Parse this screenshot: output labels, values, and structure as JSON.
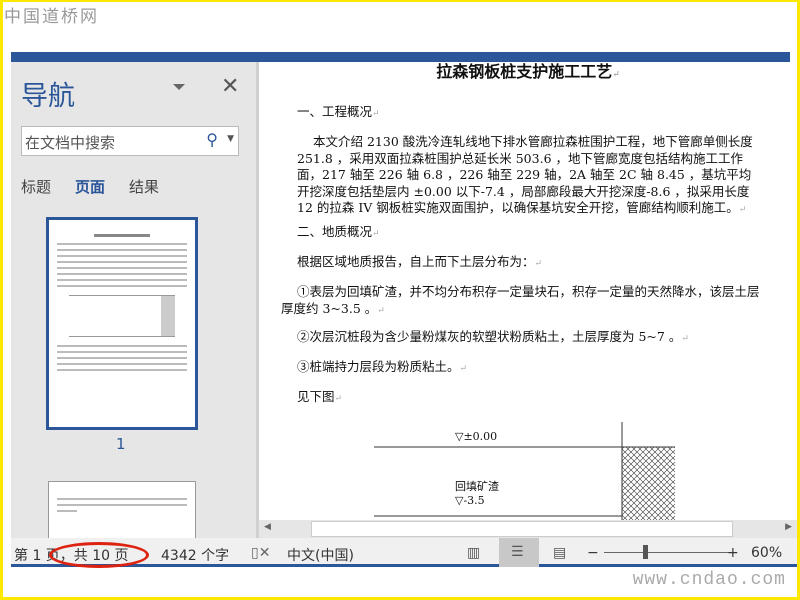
{
  "watermark_top": "中国道桥网",
  "watermark_bottom": "www.cndao.com",
  "nav": {
    "title": "导航",
    "search_placeholder": "在文档中搜索",
    "tabs": [
      "标题",
      "页面",
      "结果"
    ],
    "active_tab": "页面",
    "page_label": "1"
  },
  "doc": {
    "title": "拉森钢板桩支护施工工艺",
    "h1": "一、工程概况",
    "p1": "本文介绍 2130 酸洗冷连轧线地下排水管廊拉森桩围护工程，地下管廊单侧长度 251.8 ，采用双面拉森桩围护总延长米 503.6 ，地下管廊宽度包括结构施工工作面，217 轴至 226 轴 6.8 ，226 轴至 229 轴，2A 轴至 2C 轴 8.45 ，基坑平均开挖深度包括垫层内 ±0.00 以下-7.4 ，局部廊段最大开挖深度-8.6 ，拟采用长度 12 的拉森 IV 钢板桩实施双面围护，以确保基坑安全开挖，管廊结构顺利施工。",
    "h2": "二、地质概况",
    "p2": "根据区域地质报告，自上而下土层分布为：",
    "p3": "①表层为回填矿渣，并不均分布积存一定量块石，积存一定量的天然降水，该层土层厚度约 3~3.5 。",
    "p4": "②次层沉桩段为含少量粉煤灰的软塑状粉质粘土，土层厚度为 5~7 。",
    "p5": "③桩端持力层段为粉质粘土。",
    "p6": "见下图",
    "fig_level0": "▽±0.00",
    "fig_layer": "回填矿渣",
    "fig_level1": "▽-3.5"
  },
  "status": {
    "page": "第 1 页，共 10 页",
    "words": "4342 个字",
    "language": "中文(中国)",
    "zoom": "60%",
    "zoom_minus": "−",
    "zoom_plus": "+"
  },
  "colors": {
    "accent": "#2b579a",
    "frame": "#ffe800",
    "highlight": "#d21"
  }
}
